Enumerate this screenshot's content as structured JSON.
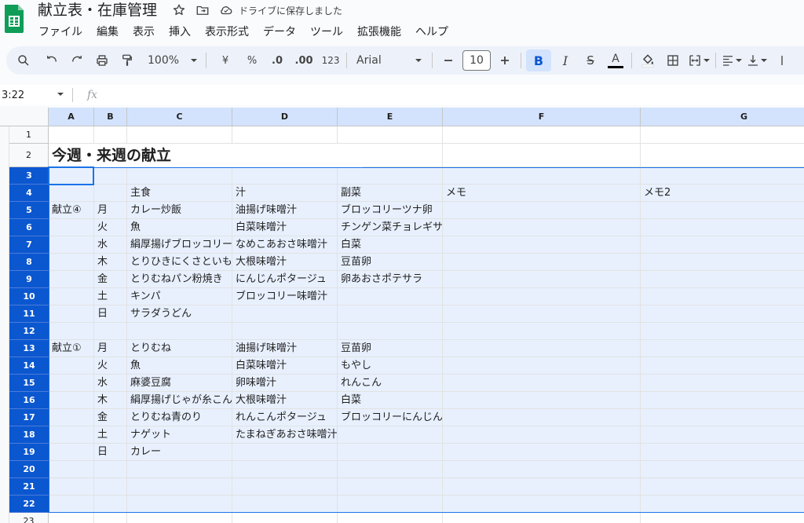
{
  "app": {
    "doc_title": "献立表・在庫管理",
    "saved_status": "ドライブに保存しました",
    "brand_color": "#0f9d58",
    "accent_color": "#0b57d0"
  },
  "menu": [
    "ファイル",
    "編集",
    "表示",
    "挿入",
    "表示形式",
    "データ",
    "ツール",
    "拡張機能",
    "ヘルプ"
  ],
  "toolbar": {
    "zoom": "100%",
    "currency": "¥",
    "percent": "%",
    "dec_decrease": ".0",
    "dec_increase": ".00",
    "number_format": "123",
    "font": "Arial",
    "font_size": "10",
    "bold": "B",
    "italic": "I",
    "strike": "S",
    "text_color": "A"
  },
  "formula_bar": {
    "name_box": "3:22",
    "fx": "fx"
  },
  "sheet": {
    "columns": [
      "A",
      "B",
      "C",
      "D",
      "E",
      "F",
      "G"
    ],
    "title": "今週・来週の献立",
    "header_row": {
      "c": "主食",
      "d": "汁",
      "e": "副菜",
      "f": "メモ",
      "g": "メモ2"
    },
    "rows": [
      {
        "num": "1"
      },
      {
        "num": "2"
      },
      {
        "num": "3"
      },
      {
        "num": "4"
      },
      {
        "num": "5",
        "a": "献立④",
        "b": "月",
        "c": "カレー炒飯",
        "d": "油揚げ味噌汁",
        "e": "ブロッコリーツナ卵"
      },
      {
        "num": "6",
        "b": "火",
        "c": "魚",
        "d": "白菜味噌汁",
        "e": "チンゲン菜チョレギサラダ"
      },
      {
        "num": "7",
        "b": "水",
        "c": "絹厚揚げブロッコリー",
        "d": "なめこあおさ味噌汁",
        "e": "白菜"
      },
      {
        "num": "8",
        "b": "木",
        "c": "とりひきにくさといも",
        "d": "大根味噌汁",
        "e": "豆苗卵"
      },
      {
        "num": "9",
        "b": "金",
        "c": "とりむねパン粉焼き",
        "d": "にんじんポタージュ",
        "e": "卵あおさポテサラ"
      },
      {
        "num": "10",
        "b": "土",
        "c": "キンパ",
        "d": "ブロッコリー味噌汁",
        "e": ""
      },
      {
        "num": "11",
        "b": "日",
        "c": "サラダうどん",
        "d": "",
        "e": ""
      },
      {
        "num": "12"
      },
      {
        "num": "13",
        "a": "献立①",
        "b": "月",
        "c": "とりむね",
        "d": "油揚げ味噌汁",
        "e": "豆苗卵"
      },
      {
        "num": "14",
        "b": "火",
        "c": "魚",
        "d": "白菜味噌汁",
        "e": "もやし"
      },
      {
        "num": "15",
        "b": "水",
        "c": "麻婆豆腐",
        "d": "卵味噌汁",
        "e": "れんこん"
      },
      {
        "num": "16",
        "b": "木",
        "c": "絹厚揚げじゃが糸こん",
        "d": "大根味噌汁",
        "e": "白菜"
      },
      {
        "num": "17",
        "b": "金",
        "c": "とりむね青のり",
        "d": "れんこんポタージュ",
        "e": "ブロッコリーにんじん"
      },
      {
        "num": "18",
        "b": "土",
        "c": "ナゲット",
        "d": "たまねぎあおさ味噌汁",
        "e": ""
      },
      {
        "num": "19",
        "b": "日",
        "c": "カレー",
        "d": "",
        "e": ""
      },
      {
        "num": "20"
      },
      {
        "num": "21"
      },
      {
        "num": "22"
      },
      {
        "num": "23"
      }
    ],
    "selected_rows": [
      "3",
      "22"
    ]
  }
}
